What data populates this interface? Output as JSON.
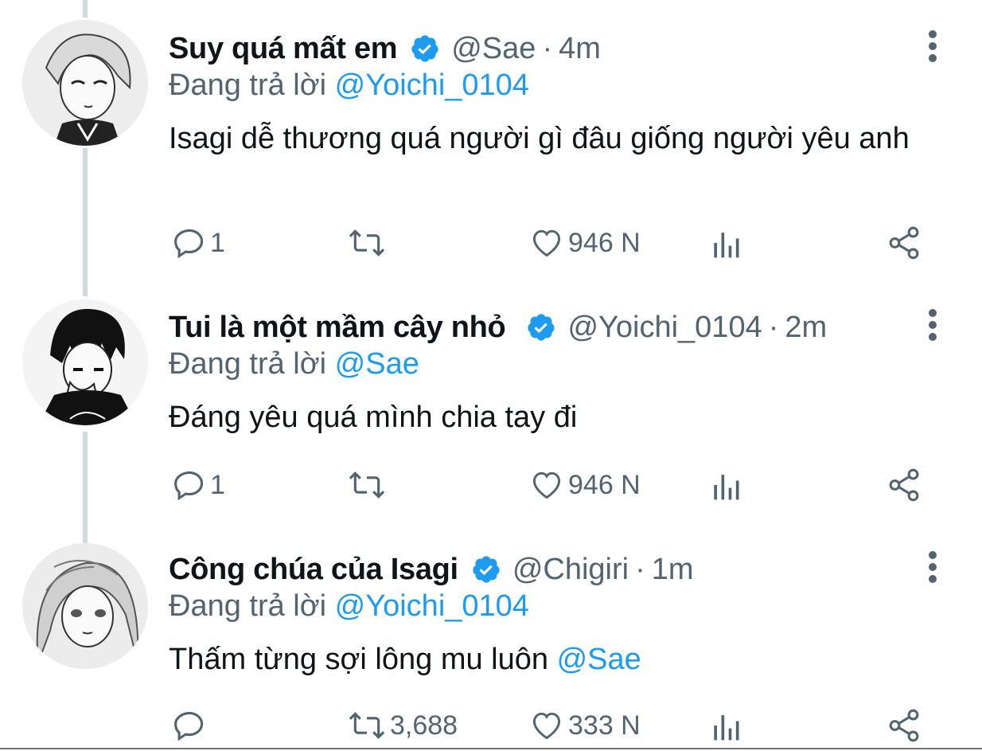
{
  "colors": {
    "verified": "#1d9bf0",
    "link": "#1d9bf0",
    "secondary_text": "#536471",
    "thread_line": "#cfd9de"
  },
  "tweets": [
    {
      "display_name": "Suy quá mất em",
      "handle": "@Sae",
      "separator": "·",
      "time": "4m",
      "replying_prefix": "Đang trả lời",
      "replying_to": "@Yoichi_0104",
      "text": "Isagi dễ thương quá người gì đâu giống người yêu anh",
      "text_mention": "",
      "reply_count": "1",
      "retweet_count": "",
      "like_count": "946 N",
      "icons": [
        "reply-icon",
        "retweet-icon",
        "like-icon",
        "analytics-icon",
        "share-icon",
        "more-icon",
        "verified-badge-icon"
      ]
    },
    {
      "display_name": "Tui là một mầm cây nhỏ",
      "handle": "@Yoichi_0104",
      "separator": "·",
      "time": "2m",
      "replying_prefix": "Đang trả lời",
      "replying_to": "@Sae",
      "text": "Đáng yêu quá mình chia tay đi",
      "text_mention": "",
      "reply_count": "1",
      "retweet_count": "",
      "like_count": "946 N"
    },
    {
      "display_name": "Công chúa của Isagi",
      "handle": "@Chigiri",
      "separator": "·",
      "time": "1m",
      "replying_prefix": "Đang trả lời",
      "replying_to": "@Yoichi_0104",
      "text": "Thấm từng sợi lông mu luôn ",
      "text_mention": "@Sae",
      "reply_count": "",
      "retweet_count": "3,688",
      "like_count": "333 N"
    }
  ]
}
